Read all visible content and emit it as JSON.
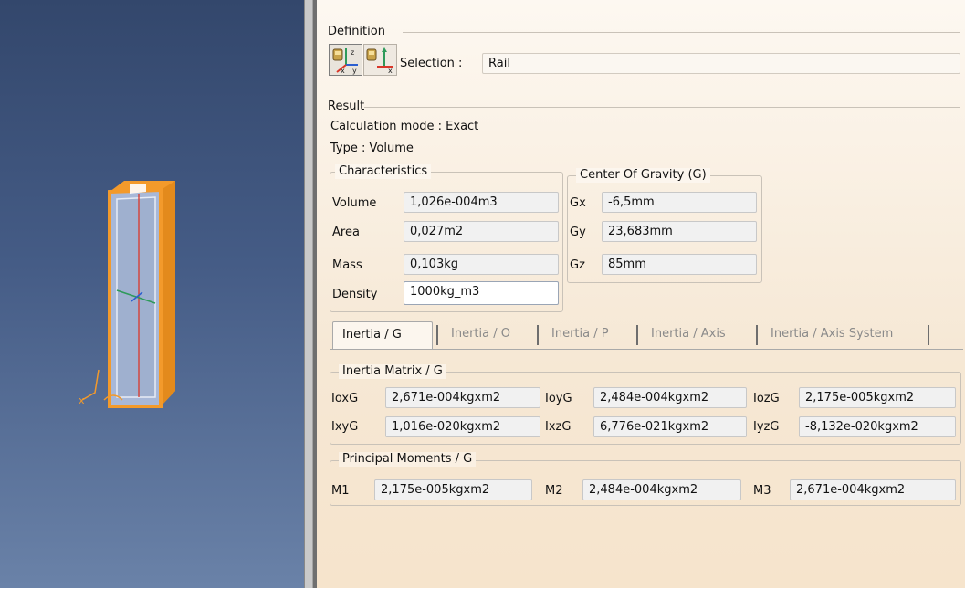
{
  "definition": {
    "title": "Definition",
    "selection_label": "Selection :",
    "selection_value": "Rail"
  },
  "result": {
    "title": "Result",
    "calc_mode": "Calculation mode : Exact",
    "type": "Type : Volume"
  },
  "characteristics": {
    "title": "Characteristics",
    "rows": [
      {
        "label": "Volume",
        "value": "1,026e-004m3"
      },
      {
        "label": "Area",
        "value": "0,027m2"
      },
      {
        "label": "Mass",
        "value": "0,103kg"
      },
      {
        "label": "Density",
        "value": "1000kg_m3"
      }
    ]
  },
  "cog": {
    "title": "Center Of Gravity (G)",
    "rows": [
      {
        "label": "Gx",
        "value": "-6,5mm"
      },
      {
        "label": "Gy",
        "value": "23,683mm"
      },
      {
        "label": "Gz",
        "value": "85mm"
      }
    ]
  },
  "tabs": [
    "Inertia / G",
    "Inertia / O",
    "Inertia / P",
    "Inertia / Axis",
    "Inertia / Axis System"
  ],
  "inertia_matrix": {
    "title": "Inertia Matrix / G",
    "row1": [
      {
        "label": "IoxG",
        "value": "2,671e-004kgxm2"
      },
      {
        "label": "IoyG",
        "value": "2,484e-004kgxm2"
      },
      {
        "label": "IozG",
        "value": "2,175e-005kgxm2"
      }
    ],
    "row2": [
      {
        "label": "IxyG",
        "value": "1,016e-020kgxm2"
      },
      {
        "label": "IxzG",
        "value": "6,776e-021kgxm2"
      },
      {
        "label": "IyzG",
        "value": "-8,132e-020kgxm2"
      }
    ]
  },
  "principal": {
    "title": "Principal Moments / G",
    "items": [
      {
        "label": "M1",
        "value": "2,175e-005kgxm2"
      },
      {
        "label": "M2",
        "value": "2,484e-004kgxm2"
      },
      {
        "label": "M3",
        "value": "2,671e-004kgxm2"
      }
    ]
  },
  "colors": {
    "part_orange": "#f39a2b",
    "axis_red": "#d9372a",
    "axis_green": "#2e9a5a",
    "axis_blue": "#2c5fd0"
  },
  "icons": [
    "measure-item-icon",
    "measure-with-axis-icon"
  ]
}
